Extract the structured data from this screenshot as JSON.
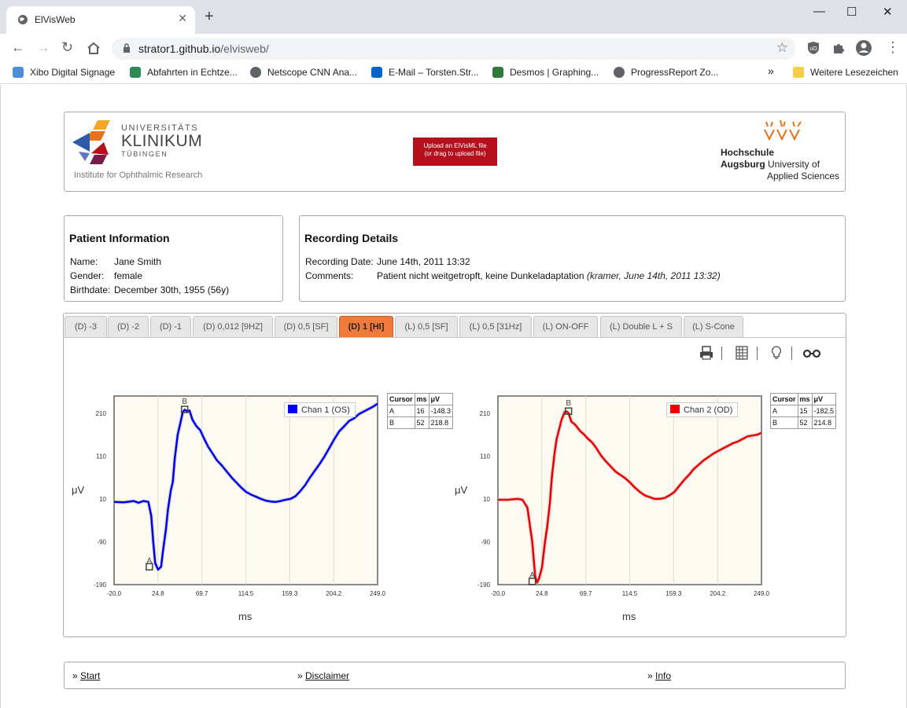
{
  "browser": {
    "tab_title": "ElVisWeb",
    "tab_close": "✕",
    "new_tab": "+",
    "url_host": "strator1.github.io",
    "url_path": "/elvisweb/",
    "window_controls": [
      "—",
      "☐",
      "✕"
    ],
    "bookmarks": [
      {
        "label": "Xibo Digital Signage",
        "icon": "xibo-icon",
        "color": "#4a90d9"
      },
      {
        "label": "Abfahrten in Echtze...",
        "icon": "transit-icon",
        "color": "#2e8b57"
      },
      {
        "label": "Netscope CNN Ana...",
        "icon": "globe-icon",
        "color": "#5f6368"
      },
      {
        "label": "E-Mail – Torsten.Str...",
        "icon": "outlook-icon",
        "color": "#0a64c8"
      },
      {
        "label": "Desmos | Graphing...",
        "icon": "desmos-icon",
        "color": "#2f7a3a"
      },
      {
        "label": "ProgressReport Zo...",
        "icon": "globe-icon",
        "color": "#5f6368"
      }
    ],
    "more_bookmarks": "»",
    "other_bookmarks": "Weitere Lesezeichen"
  },
  "header": {
    "ukt_line1": "UNIVERSITÄTS",
    "ukt_line2": "KLINIKUM",
    "ukt_line3": "TÜBINGEN",
    "institute": "Institute for Ophthalmic Research",
    "upload_line1": "Upload an ElVisML file",
    "upload_line2": "(or drag to upload file)",
    "hs_line1": "Hochschule",
    "hs_line2_bold": "Augsburg",
    "hs_line2_rest": " University of",
    "hs_line3": "Applied Sciences"
  },
  "patient": {
    "title": "Patient Information",
    "name_label": "Name:",
    "name": "Jane Smith",
    "gender_label": "Gender:",
    "gender": "female",
    "birth_label": "Birthdate:",
    "birthdate": "December 30th, 1955 (56y)"
  },
  "recording": {
    "title": "Recording Details",
    "date_label": "Recording Date:",
    "date": "June 14th, 2011 13:32",
    "comments_label": "Comments:",
    "comment": "Patient nicht weitgetropft, keine Dunkeladaptation ",
    "comment_meta": "(kramer, June 14th, 2011 13:32)"
  },
  "tabs": [
    {
      "label": "(D) -3",
      "active": false
    },
    {
      "label": "(D) -2",
      "active": false
    },
    {
      "label": "(D) -1",
      "active": false
    },
    {
      "label": "(D) 0,012 [9HZ]",
      "active": false
    },
    {
      "label": "(D) 0,5 [SF]",
      "active": false
    },
    {
      "label": "(D) 1 [HI]",
      "active": true
    },
    {
      "label": "(L) 0,5 [SF]",
      "active": false
    },
    {
      "label": "(L) 0,5 [31Hz]",
      "active": false
    },
    {
      "label": "(L) ON-OFF",
      "active": false
    },
    {
      "label": "(L) Double L + S",
      "active": false
    },
    {
      "label": "(L) S-Cone",
      "active": false
    }
  ],
  "tools": [
    "print-icon",
    "table-icon",
    "lightbulb-icon",
    "glasses-icon"
  ],
  "cursor_headers": [
    "Cursor",
    "ms",
    "μV"
  ],
  "chart_data": [
    {
      "type": "line",
      "series": [
        {
          "name": "Chan 1 (OS)",
          "color": "#0000ee"
        }
      ],
      "xlabel": "ms",
      "ylabel": "μV",
      "xlim": [
        -20.0,
        249.0
      ],
      "ylim": [
        -190,
        250
      ],
      "xticks": [
        "-20.0",
        "24.8",
        "69.7",
        "114.5",
        "159.3",
        "204.2",
        "249.0"
      ],
      "yticks": [
        "210",
        "110",
        "10",
        "-90",
        "-190"
      ],
      "x": [
        -20,
        -10,
        0,
        5,
        10,
        15,
        18,
        20,
        22,
        25,
        28,
        30,
        33,
        35,
        38,
        40,
        42,
        45,
        48,
        50,
        52,
        55,
        57,
        60,
        64,
        68,
        72,
        76,
        80,
        85,
        90,
        95,
        100,
        105,
        110,
        115,
        120,
        125,
        130,
        135,
        140,
        145,
        150,
        155,
        160,
        165,
        170,
        175,
        180,
        185,
        190,
        195,
        200,
        205,
        210,
        215,
        220,
        225,
        230,
        235,
        240,
        245,
        249
      ],
      "y": [
        3,
        2,
        5,
        1,
        5,
        3,
        -30,
        -90,
        -140,
        -155,
        -148,
        -110,
        -60,
        -15,
        30,
        50,
        105,
        160,
        190,
        212,
        218,
        214,
        216,
        195,
        180,
        170,
        150,
        132,
        118,
        100,
        88,
        74,
        60,
        48,
        36,
        26,
        20,
        15,
        10,
        6,
        4,
        3,
        5,
        8,
        10,
        16,
        28,
        42,
        60,
        76,
        92,
        110,
        130,
        150,
        168,
        180,
        192,
        198,
        208,
        214,
        220,
        226,
        232
      ],
      "cursors": [
        {
          "label": "A",
          "ms": "16",
          "uv": "-148.3"
        },
        {
          "label": "B",
          "ms": "52",
          "uv": "218.8"
        }
      ]
    },
    {
      "type": "line",
      "series": [
        {
          "name": "Chan 2 (OD)",
          "color": "#ee0000"
        }
      ],
      "xlabel": "ms",
      "ylabel": "μV",
      "xlim": [
        -20.0,
        249.0
      ],
      "ylim": [
        -190,
        250
      ],
      "xticks": [
        "-20.0",
        "24.8",
        "69.7",
        "114.5",
        "159.3",
        "204.2",
        "249.0"
      ],
      "yticks": [
        "210",
        "110",
        "10",
        "-90",
        "-190"
      ],
      "x": [
        -20,
        -10,
        0,
        5,
        10,
        15,
        18,
        20,
        22,
        25,
        28,
        30,
        33,
        35,
        38,
        40,
        45,
        48,
        50,
        52,
        55,
        58,
        60,
        64,
        68,
        72,
        76,
        80,
        85,
        90,
        95,
        100,
        105,
        110,
        115,
        120,
        125,
        130,
        135,
        140,
        145,
        150,
        155,
        160,
        165,
        170,
        175,
        180,
        185,
        190,
        195,
        200,
        205,
        210,
        215,
        220,
        225,
        230,
        235,
        240,
        245,
        249
      ],
      "y": [
        8,
        8,
        10,
        8,
        -10,
        -90,
        -170,
        -185,
        -175,
        -150,
        -90,
        -60,
        0,
        60,
        120,
        150,
        195,
        212,
        214,
        210,
        190,
        185,
        180,
        168,
        160,
        150,
        142,
        130,
        112,
        98,
        86,
        74,
        66,
        58,
        48,
        36,
        26,
        18,
        14,
        10,
        10,
        12,
        18,
        26,
        40,
        54,
        66,
        80,
        90,
        100,
        108,
        116,
        122,
        128,
        134,
        140,
        144,
        150,
        156,
        158,
        160,
        164
      ],
      "cursors": [
        {
          "label": "A",
          "ms": "15",
          "uv": "-182.5"
        },
        {
          "label": "B",
          "ms": "52",
          "uv": "214.8"
        }
      ]
    }
  ],
  "footer": {
    "links": [
      {
        "prefix": "» ",
        "label": "Start"
      },
      {
        "prefix": "» ",
        "label": "Disclaimer"
      },
      {
        "prefix": "» ",
        "label": "Info"
      }
    ]
  }
}
